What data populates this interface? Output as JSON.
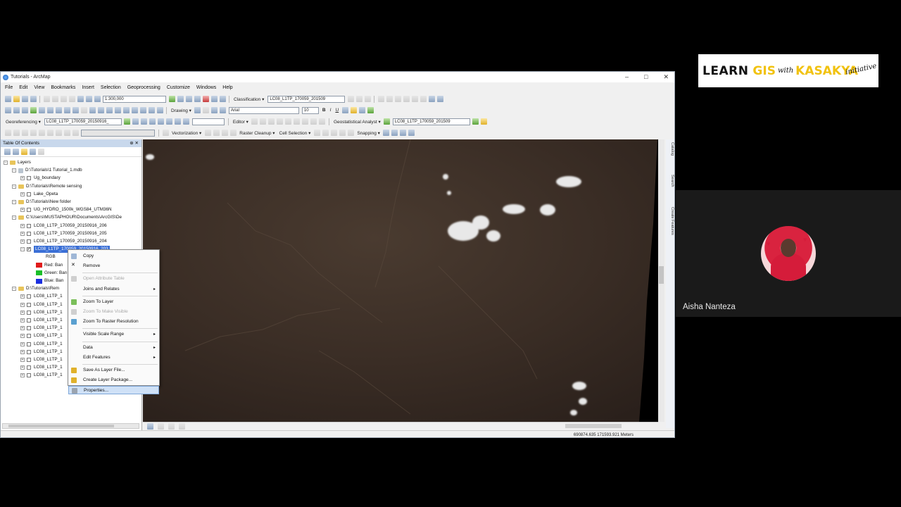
{
  "window": {
    "title": "Tutorials - ArcMap",
    "controls": {
      "minimize": "–",
      "maximize": "□",
      "close": "✕"
    }
  },
  "menu": [
    "File",
    "Edit",
    "View",
    "Bookmarks",
    "Insert",
    "Selection",
    "Geoprocessing",
    "Customize",
    "Windows",
    "Help"
  ],
  "toolbar": {
    "scale": "1:300,000",
    "classification_label": "Classification ▾",
    "classification_layer": "LC08_L1TP_170059_201509",
    "drawing_label": "Drawing ▾",
    "font_name": "Arial",
    "font_size": "10",
    "georeferencing_label": "Georeferencing ▾",
    "georef_layer": "LC08_L1TP_170059_20150916_",
    "editor_label": "Editor ▾",
    "geostat_label": "Geostatistical Analyst ▾",
    "geostat_layer": "LC08_L1TP_170059_201509",
    "vectorization_label": "Vectorization ▾",
    "raster_cleanup_label": "Raster Cleanup ▾",
    "cell_selection_label": "Cell Selection ▾",
    "snapping_label": "Snapping ▾"
  },
  "toc": {
    "title": "Table Of Contents",
    "pin": "⊕ ✕",
    "root": "Layers",
    "groups": [
      {
        "path": "D:\\Tutorials\\1 Tutorial_1.mdb",
        "layers": [
          "Ug_boundary"
        ]
      },
      {
        "path": "D:\\Tutorials\\Remote sensing",
        "layers": [
          "Lake_Opeta"
        ]
      },
      {
        "path": "D:\\Tutorials\\New folder",
        "layers": [
          "UG_HYDRO_1500k_WGS84_UTM36N"
        ]
      },
      {
        "path": "C:\\Users\\MUSTAPHOUR\\Documents\\ArcGIS\\De",
        "layers": [
          "LC08_L1TP_170059_20150916_206",
          "LC08_L1TP_170059_20150916_205",
          "LC08_L1TP_170059_20150916_204",
          "LC08_L1TP_170059_20150916_203"
        ]
      }
    ],
    "rgb_label": "RGB",
    "bands": [
      {
        "label": "Red:",
        "band": "Ban",
        "color": "#e01b1b"
      },
      {
        "label": "Green:",
        "band": "Ban",
        "color": "#1bbf2a"
      },
      {
        "label": "Blue:",
        "band": "Ban",
        "color": "#1b2fe0"
      }
    ],
    "group5_path": "D:\\Tutorials\\Rem",
    "group5_layers": [
      "LC08_L1TP_1",
      "LC08_L1TP_1",
      "LC08_L1TP_1",
      "LC08_L1TP_1",
      "LC08_L1TP_1",
      "LC08_L1TP_1",
      "LC08_L1TP_1",
      "LC08_L1TP_1",
      "LC08_L1TP_1",
      "LC08_L1TP_1",
      "LC08_L1TP_1"
    ]
  },
  "context_menu": [
    {
      "label": "Copy",
      "enabled": true,
      "icon": "copy-icon",
      "submenu": false
    },
    {
      "label": "Remove",
      "enabled": true,
      "icon": "remove-icon",
      "submenu": false
    },
    {
      "label": "Open Attribute Table",
      "enabled": false,
      "icon": "table-icon",
      "submenu": false
    },
    {
      "label": "Joins and Relates",
      "enabled": true,
      "icon": "",
      "submenu": true
    },
    {
      "label": "Zoom To Layer",
      "enabled": true,
      "icon": "zoom-layer-icon",
      "submenu": false
    },
    {
      "label": "Zoom To Make Visible",
      "enabled": false,
      "icon": "zoom-visible-icon",
      "submenu": false
    },
    {
      "label": "Zoom To Raster Resolution",
      "enabled": true,
      "icon": "zoom-raster-icon",
      "submenu": false
    },
    {
      "label": "Visible Scale Range",
      "enabled": true,
      "icon": "",
      "submenu": true
    },
    {
      "label": "Data",
      "enabled": true,
      "icon": "",
      "submenu": true
    },
    {
      "label": "Edit Features",
      "enabled": true,
      "icon": "",
      "submenu": true
    },
    {
      "label": "Save As Layer File...",
      "enabled": true,
      "icon": "save-layer-icon",
      "submenu": false
    },
    {
      "label": "Create Layer Package...",
      "enabled": true,
      "icon": "package-icon",
      "submenu": false
    },
    {
      "label": "Properties...",
      "enabled": true,
      "icon": "properties-icon",
      "submenu": false,
      "hovered": true
    }
  ],
  "side_tabs": [
    "Catalog",
    "Search",
    "Create Features"
  ],
  "status": {
    "coords": "690874.635  171593.921 Meters"
  },
  "branding": {
    "learn": "LEARN",
    "gis": "GIS",
    "with": "with",
    "kasakya": "KASAKYA",
    "initiative": "initiative"
  },
  "participant": {
    "name": "Aisha Nanteza"
  },
  "colors": {
    "accent": "#f1c20f",
    "selection": "#3a6fd6"
  }
}
